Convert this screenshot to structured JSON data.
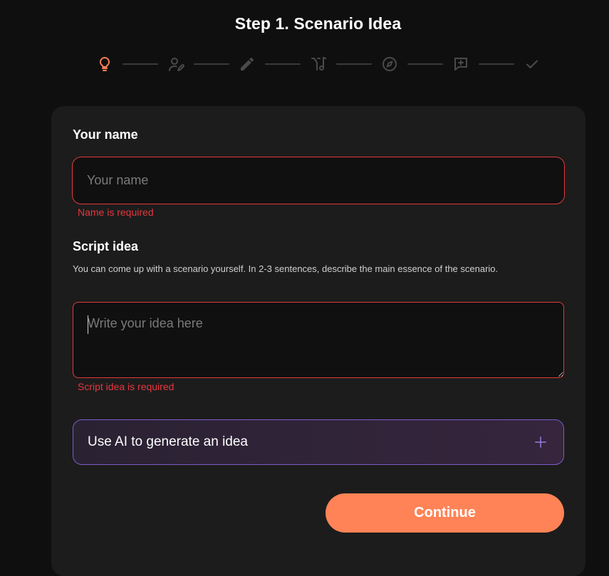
{
  "header": {
    "title": "Step 1. Scenario Idea"
  },
  "stepper": {
    "active_color": "#ff8356",
    "inactive_color": "#4a4a4a",
    "steps": [
      {
        "icon": "lightbulb-icon",
        "state": "active"
      },
      {
        "icon": "user-edit-icon",
        "state": "inactive"
      },
      {
        "icon": "pencil-icon",
        "state": "inactive"
      },
      {
        "icon": "music-split-icon",
        "state": "inactive"
      },
      {
        "icon": "compass-icon",
        "state": "inactive"
      },
      {
        "icon": "comment-plus-icon",
        "state": "inactive"
      },
      {
        "icon": "check-icon",
        "state": "inactive"
      }
    ]
  },
  "form": {
    "name": {
      "label": "Your name",
      "placeholder": "Your name",
      "value": "",
      "error": "Name is required"
    },
    "idea": {
      "label": "Script idea",
      "hint": "You can come up with a scenario yourself. In 2-3 sentences, describe the main essence of the scenario.",
      "placeholder": "Write your idea here",
      "value": "",
      "error": "Script idea is required"
    },
    "ai_generate": {
      "label": "Use AI to generate an idea",
      "icon": "plus-icon"
    },
    "continue_label": "Continue"
  },
  "colors": {
    "accent": "#ff8356",
    "error": "#e5373f",
    "ai_border": "#7a5cc8"
  }
}
